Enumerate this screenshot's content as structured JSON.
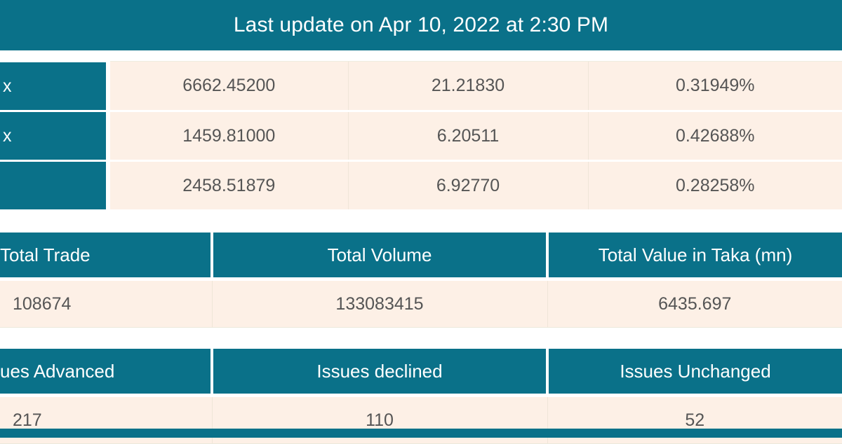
{
  "banner": {
    "text": "Last update on Apr 10, 2022 at 2:30 PM"
  },
  "colors": {
    "teal": "#0a7189",
    "cream": "#fdf0e6",
    "text": "#555555",
    "white": "#ffffff"
  },
  "index_table": {
    "rows": [
      {
        "label": "x",
        "value": "6662.45200",
        "change": "21.21830",
        "percent": "0.31949%"
      },
      {
        "label": "x",
        "value": "1459.81000",
        "change": "6.20511",
        "percent": "0.42688%"
      },
      {
        "label": "",
        "value": "2458.51879",
        "change": "6.92770",
        "percent": "0.28258%"
      }
    ]
  },
  "trade_summary": {
    "headers": [
      "Total Trade",
      "Total Volume",
      "Total Value in Taka (mn)"
    ],
    "values": [
      "108674",
      "133083415",
      "6435.697"
    ]
  },
  "issues_summary": {
    "headers": [
      "ues Advanced",
      "Issues declined",
      "Issues Unchanged"
    ],
    "values": [
      "217",
      "110",
      "52"
    ]
  }
}
